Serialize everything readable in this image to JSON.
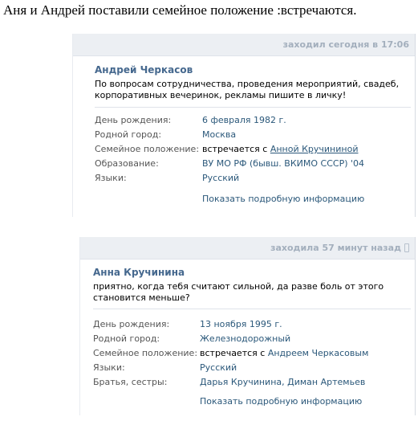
{
  "caption": "Аня и Андрей поставили семейное положение :встречаются.",
  "profiles": [
    {
      "last_seen": "заходил сегодня в 17:06",
      "name": "Андрей Черкасов",
      "status": "По вопросам сотрудничества, проведения мероприятий, свадеб, корпоративных вечеринок, рекламы пишите в личку!",
      "birthday_label": "День рождения:",
      "birthday": "6 февраля 1982 г.",
      "hometown_label": "Родной город:",
      "hometown": "Москва",
      "relationship_label": "Семейное положение:",
      "relationship_text": "встречается с",
      "relationship_partner": "Анной Кручининой",
      "education_label": "Образование:",
      "education": "ВУ МО РФ (бывш. ВКИМО СССР) '04",
      "languages_label": "Языки:",
      "languages": "Русский",
      "more_link": "Показать подробную информацию"
    },
    {
      "last_seen": "заходила 57 минут назад",
      "name": "Анна Кручинина",
      "status": "приятно, когда тебя считают сильной, да разве боль от этого становится меньше?",
      "birthday_label": "День рождения:",
      "birthday": "13 ноября 1995 г.",
      "hometown_label": "Родной город:",
      "hometown": "Железнодорожный",
      "relationship_label": "Семейное положение:",
      "relationship_text": "встречается с",
      "relationship_partner": "Андреем Черкасовым",
      "languages_label": "Языки:",
      "languages": "Русский",
      "siblings_label": "Братья, сестры:",
      "siblings": "Дарья Кручинина, Диман Артемьев",
      "more_link": "Показать подробную информацию"
    }
  ]
}
